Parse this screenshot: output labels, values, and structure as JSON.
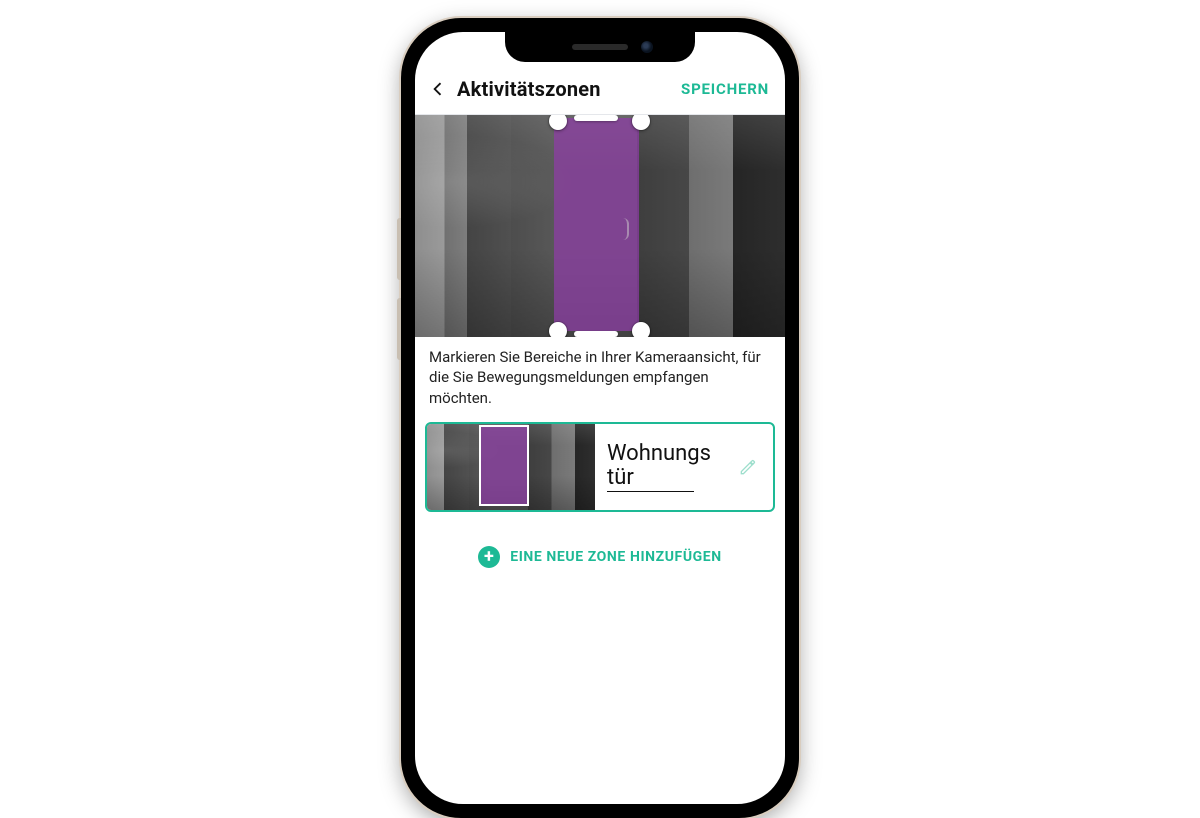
{
  "colors": {
    "accent": "#1db995",
    "zone": "#8f3da7"
  },
  "header": {
    "title": "Aktivitätszonen",
    "save_label": "SPEICHERN"
  },
  "preview": {
    "zone_overlay_color": "#8f3da7"
  },
  "instruction": "Markieren Sie Bereiche in Ihrer Kameraansicht, für die Sie Bewegungsmeldungen empfangen möchten.",
  "zones": [
    {
      "name_line1": "Wohnungs",
      "name_line2": "tür"
    }
  ],
  "add_button_label": "EINE NEUE ZONE HINZUFÜGEN"
}
